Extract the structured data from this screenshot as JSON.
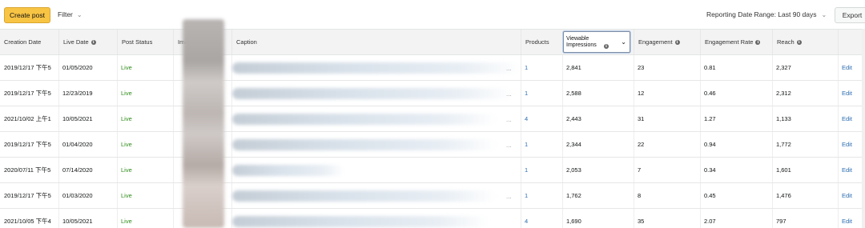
{
  "toolbar": {
    "create_label": "Create post",
    "filter_label": "Filter",
    "range_label": "Reporting Date Range: Last 90 days",
    "export_label": "Export"
  },
  "columns": {
    "creation_date": "Creation Date",
    "live_date": "Live Date",
    "post_status": "Post Status",
    "image": "Image",
    "caption": "Caption",
    "products": "Products",
    "viewable_impressions": "Viewable Impressions",
    "engagement": "Engagement",
    "engagement_rate": "Engagement Rate",
    "reach": "Reach"
  },
  "rows": [
    {
      "creation": "2019/12/17 下午5",
      "live": "01/05/2020",
      "status": "Live",
      "products": "1",
      "impressions": "2,841",
      "engagement": "23",
      "rate": "0.81",
      "reach": "2,327",
      "action": "Edit"
    },
    {
      "creation": "2019/12/17 下午5",
      "live": "12/23/2019",
      "status": "Live",
      "products": "1",
      "impressions": "2,588",
      "engagement": "12",
      "rate": "0.46",
      "reach": "2,312",
      "action": "Edit"
    },
    {
      "creation": "2021/10/02 上午1",
      "live": "10/05/2021",
      "status": "Live",
      "products": "4",
      "impressions": "2,443",
      "engagement": "31",
      "rate": "1.27",
      "reach": "1,133",
      "action": "Edit"
    },
    {
      "creation": "2019/12/17 下午5",
      "live": "01/04/2020",
      "status": "Live",
      "products": "1",
      "impressions": "2,344",
      "engagement": "22",
      "rate": "0.94",
      "reach": "1,772",
      "action": "Edit"
    },
    {
      "creation": "2020/07/11 下午5",
      "live": "07/14/2020",
      "status": "Live",
      "products": "1",
      "impressions": "2,053",
      "engagement": "7",
      "rate": "0.34",
      "reach": "1,601",
      "action": "Edit"
    },
    {
      "creation": "2019/12/17 下午5",
      "live": "01/03/2020",
      "status": "Live",
      "products": "1",
      "impressions": "1,762",
      "engagement": "8",
      "rate": "0.45",
      "reach": "1,476",
      "action": "Edit"
    },
    {
      "creation": "2021/10/05 下午4",
      "live": "10/05/2021",
      "status": "Live",
      "products": "4",
      "impressions": "1,690",
      "engagement": "35",
      "rate": "2.07",
      "reach": "797",
      "action": "Edit"
    }
  ],
  "colors": {
    "accent": "#f8c444",
    "live": "#2e8b1a",
    "link": "#2b6cb0"
  },
  "icons": {
    "info": "info-icon",
    "chevron": "chevron-down-icon"
  }
}
